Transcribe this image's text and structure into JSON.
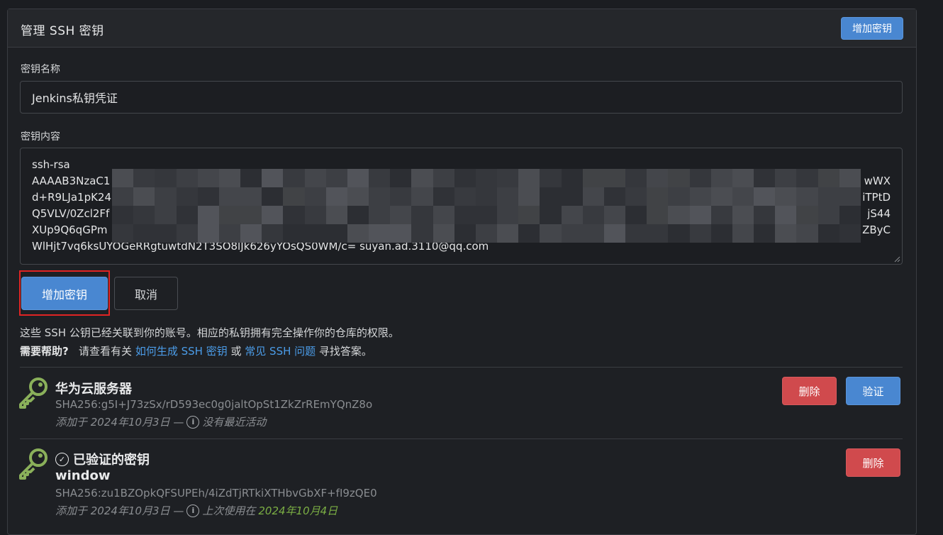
{
  "header": {
    "title": "管理 SSH 密钥",
    "add_key_button": "增加密钥"
  },
  "form": {
    "name_label": "密钥名称",
    "name_value": "Jenkins私钥凭证",
    "content_label": "密钥内容",
    "content_lines": [
      {
        "left": "ssh-rsa",
        "right": ""
      },
      {
        "left": "AAAAB3NzaC1",
        "right": "wWX"
      },
      {
        "left": "d+R9LJa1pK24",
        "right": "iTPtD"
      },
      {
        "left": "Q5VLV/0Zcl2Ff",
        "right": "jS44"
      },
      {
        "left": "XUp9Q6qGPm",
        "right": "ZByC"
      },
      {
        "left": "WlHjt7vq6ksUYOGeRRgtuwtdN2T3SO8lJk626yYOsQS0WM/c= suyan.ad.3110@qq.com",
        "right": ""
      }
    ],
    "submit_button": "增加密钥",
    "cancel_button": "取消"
  },
  "help": {
    "line1": "这些 SSH 公钥已经关联到你的账号。相应的私钥拥有完全操作你的仓库的权限。",
    "need_help": "需要帮助?",
    "see_about": "请查看有关",
    "link1": "如何生成 SSH 密钥",
    "or": "或",
    "link2": "常见 SSH 问题",
    "tail": "寻找答案。"
  },
  "keys": [
    {
      "title": "华为云服务器",
      "fingerprint": "SHA256:g5I+J73zSx/rD593ec0g0jaltOpSt1ZkZrREmYQnZ8o",
      "added": "添加于 2024年10月3日 —",
      "activity": "没有最近活动",
      "delete_button": "删除",
      "verify_button": "验证"
    },
    {
      "title": "已验证的密钥",
      "subtitle": "window",
      "fingerprint": "SHA256:zu1BZOpkQFSUPEh/4iZdTjRTkiXTHbvGbXF+fI9zQE0",
      "added": "添加于 2024年10月3日 —",
      "activity": "上次使用在",
      "last_used": "2024年10月4日",
      "delete_button": "删除"
    }
  ],
  "colors": {
    "primary": "#4987d1",
    "danger": "#d04a4d",
    "link": "#4b9ce8",
    "key_icon": "#8ab05a",
    "focus_outline": "#e02424"
  }
}
